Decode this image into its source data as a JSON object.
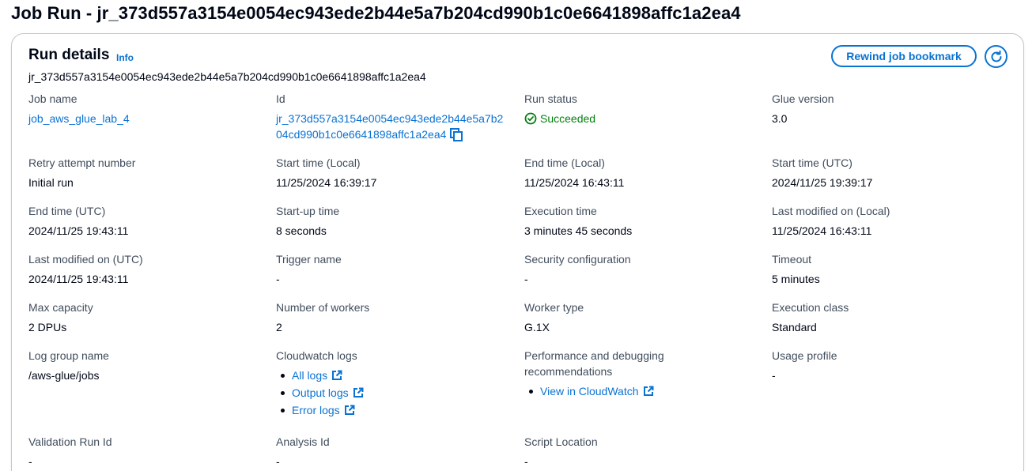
{
  "page": {
    "title": "Job Run - jr_373d557a3154e0054ec943ede2b44e5a7b204cd990b1c0e6641898affc1a2ea4"
  },
  "panel": {
    "title": "Run details",
    "info_label": "Info",
    "run_id": "jr_373d557a3154e0054ec943ede2b44e5a7b204cd990b1c0e6641898affc1a2ea4",
    "rewind_label": "Rewind job bookmark",
    "refresh_icon": "refresh-icon"
  },
  "fields": {
    "job_name": {
      "label": "Job name",
      "value": "job_aws_glue_lab_4"
    },
    "id": {
      "label": "Id",
      "value_line1": "jr_373d557a3154e0054ec943ede2b44e5a7b2",
      "value_line2": "04cd990b1c0e6641898affc1a2ea4",
      "icon": "copy-icon"
    },
    "run_status": {
      "label": "Run status",
      "value": "Succeeded",
      "icon": "success-check-icon",
      "color": "#037f0c"
    },
    "glue_version": {
      "label": "Glue version",
      "value": "3.0"
    },
    "retry_attempt": {
      "label": "Retry attempt number",
      "value": "Initial run"
    },
    "start_time_local": {
      "label": "Start time (Local)",
      "value": "11/25/2024 16:39:17"
    },
    "end_time_local": {
      "label": "End time (Local)",
      "value": "11/25/2024 16:43:11"
    },
    "start_time_utc": {
      "label": "Start time (UTC)",
      "value": "2024/11/25 19:39:17"
    },
    "end_time_utc": {
      "label": "End time (UTC)",
      "value": "2024/11/25 19:43:11"
    },
    "startup_time": {
      "label": "Start-up time",
      "value": "8 seconds"
    },
    "execution_time": {
      "label": "Execution time",
      "value": "3 minutes 45 seconds"
    },
    "last_modified_local": {
      "label": "Last modified on (Local)",
      "value": "11/25/2024 16:43:11"
    },
    "last_modified_utc": {
      "label": "Last modified on (UTC)",
      "value": "2024/11/25 19:43:11"
    },
    "trigger_name": {
      "label": "Trigger name",
      "value": "-"
    },
    "security_config": {
      "label": "Security configuration",
      "value": "-"
    },
    "timeout": {
      "label": "Timeout",
      "value": "5 minutes"
    },
    "max_capacity": {
      "label": "Max capacity",
      "value": "2 DPUs"
    },
    "num_workers": {
      "label": "Number of workers",
      "value": "2"
    },
    "worker_type": {
      "label": "Worker type",
      "value": "G.1X"
    },
    "execution_class": {
      "label": "Execution class",
      "value": "Standard"
    },
    "log_group": {
      "label": "Log group name",
      "value": "/aws-glue/jobs"
    },
    "cloudwatch_logs": {
      "label": "Cloudwatch logs",
      "links": [
        "All logs",
        "Output logs",
        "Error logs"
      ],
      "icon": "external-link-icon"
    },
    "perf_debug": {
      "label": "Performance and debugging recommendations",
      "links": [
        "View in CloudWatch"
      ]
    },
    "usage_profile": {
      "label": "Usage profile",
      "value": "-"
    },
    "validation_run_id": {
      "label": "Validation Run Id",
      "value": "-"
    },
    "analysis_id": {
      "label": "Analysis Id",
      "value": "-"
    },
    "script_location": {
      "label": "Script Location",
      "value": "-"
    }
  },
  "colors": {
    "link": "#0972d3",
    "success": "#037f0c",
    "label": "#414d5c",
    "text": "#000716"
  }
}
